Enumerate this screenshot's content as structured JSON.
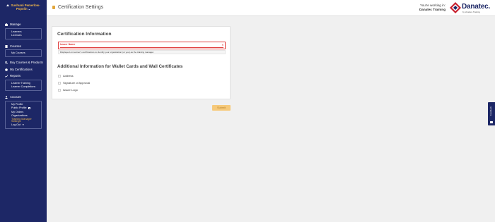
{
  "sidebar": {
    "user_name_line1": "Sushumi Pemerlow-",
    "user_name_line2": "Popolin",
    "manage": {
      "title": "Manage",
      "items": [
        "Learners",
        "Licenses"
      ]
    },
    "courses": {
      "title": "Courses",
      "items": [
        "My Courses"
      ]
    },
    "buy_courses": "Buy Courses & Products",
    "my_certifications": "My Certifications",
    "reports": {
      "title": "Reports",
      "items": [
        "Learner Training",
        "Learner Completions"
      ]
    },
    "account": {
      "title": "Account",
      "items": [
        "My Profile",
        "Public Profile",
        "My Orders",
        "Organizations",
        "Training Manager Settings",
        "Log Out"
      ]
    }
  },
  "header": {
    "title": "Certification Settings",
    "working_in_label": "You're working in:",
    "working_in_value": "Danatec Training",
    "logo_text": "Danatec.",
    "logo_sub": "by Vendere Training"
  },
  "card": {
    "heading": "Certification Information",
    "issuer_name_label": "Issuer Name",
    "issuer_name_value": "",
    "clear_icon": "×",
    "help_text": "Displayed on learner's certifications to identify your organization (or you) as the training manager.",
    "additional_heading": "Additional Information for Wallet Cards and Wall Certificates",
    "checkboxes": [
      "Address",
      "Signature of Approval",
      "Issuer Logo"
    ]
  },
  "submit_label": "Submit",
  "feedback_label": "Feedback",
  "colors": {
    "sidebar": "#1d2766",
    "accent": "#f2b84a",
    "error": "#e04040"
  }
}
